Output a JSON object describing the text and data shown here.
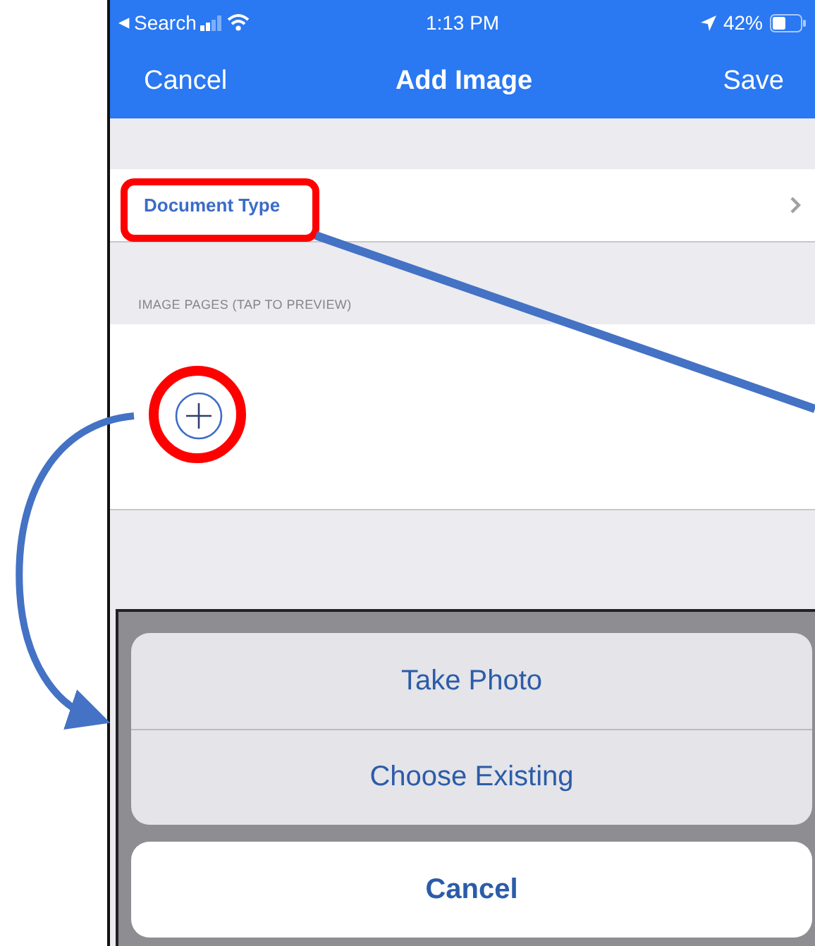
{
  "status_bar": {
    "back_glyph": "◀",
    "back_label": "Search",
    "time": "1:13 PM",
    "battery": "42%"
  },
  "nav_bar": {
    "left": "Cancel",
    "title": "Add Image",
    "right": "Save"
  },
  "document_type_row": {
    "label": "Document Type"
  },
  "image_pages": {
    "header": "IMAGE PAGES (TAP TO PREVIEW)"
  },
  "action_sheet": {
    "actions": [
      {
        "label": "Take Photo"
      },
      {
        "label": "Choose Existing"
      }
    ],
    "cancel": "Cancel"
  }
}
